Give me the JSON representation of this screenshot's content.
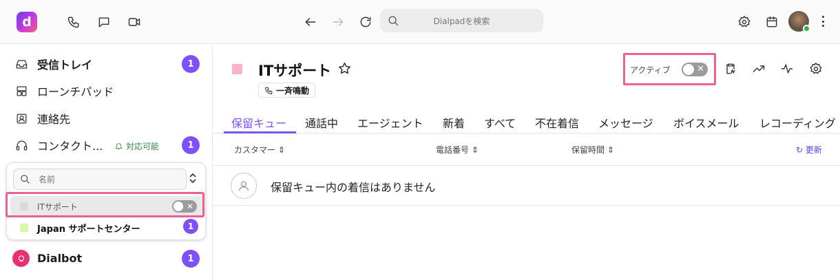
{
  "topbar": {
    "logo_letter": "d",
    "search_placeholder": "Dialpadを検索",
    "icons": [
      "phone-icon",
      "chat-icon",
      "video-icon",
      "back-arrow-icon",
      "forward-arrow-icon",
      "reload-icon",
      "settings-icon",
      "calendar-icon",
      "more-icon"
    ]
  },
  "sidebar": {
    "inbox": {
      "label": "受信トレイ",
      "badge": "1"
    },
    "launchpad": {
      "label": "ローンチパッド"
    },
    "contacts": {
      "label": "連絡先"
    },
    "contact_center": {
      "label": "コンタクト...",
      "status": "対応可能",
      "badge": "1"
    },
    "center_panel": {
      "search_placeholder": "名前",
      "items": [
        {
          "label": "ITサポート",
          "color": "#d9d9d9"
        },
        {
          "label": "Japan サポートセンター",
          "color": "#d9f7a8",
          "badge": "1"
        }
      ]
    },
    "dialbot": {
      "label": "Dialbot",
      "badge": "1"
    }
  },
  "main": {
    "title": "ITサポート",
    "title_color": "#f9b1cc",
    "ring_chip": "一斉鳴動",
    "active_label": "アクティブ",
    "active_on": false,
    "tabs": [
      "保留キュー",
      "通話中",
      "エージェント",
      "新着",
      "すべて",
      "不在着信",
      "メッセージ",
      "ボイスメール",
      "レコーディング"
    ],
    "columns": [
      "カスタマー",
      "電話番号",
      "保留時間"
    ],
    "refresh_label": "更新",
    "empty_message": "保留キュー内の着信はありません"
  },
  "colors": {
    "accent": "#7c52ff",
    "highlight": "#ee5f94",
    "dialbot": "#ec2f6e",
    "available": "#2e8a3e"
  }
}
